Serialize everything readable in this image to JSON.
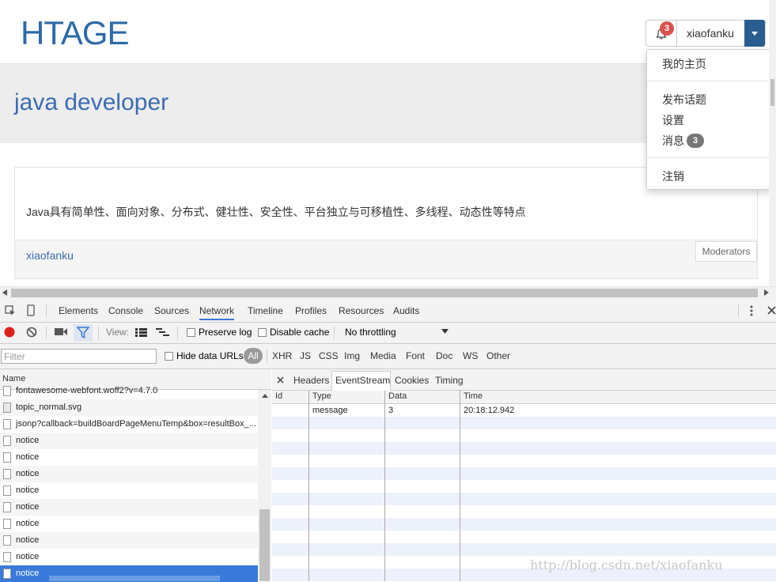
{
  "site": {
    "logo": "HTAGE",
    "banner_title": "java developer",
    "card_description": "Java具有简单性、面向对象、分布式、健壮性、安全性、平台独立与可移植性、多线程、动态性等特点",
    "card_user": "xiaofanku",
    "moderators_label": "Moderators",
    "notification_count": "3",
    "username": "xiaofanku"
  },
  "user_menu": {
    "items": [
      {
        "label": "我的主页"
      },
      {
        "label": "发布话题"
      },
      {
        "label": "设置"
      },
      {
        "label": "消息"
      },
      {
        "label": "注销"
      }
    ],
    "messages_badge": "3"
  },
  "devtools": {
    "tabs": [
      "Elements",
      "Console",
      "Sources",
      "Network",
      "Timeline",
      "Profiles",
      "Resources",
      "Audits"
    ],
    "active_tab": "Network",
    "toolbar": {
      "view_label": "View:",
      "preserve_log": "Preserve log",
      "disable_cache": "Disable cache",
      "throttling": "No throttling"
    },
    "filter": {
      "placeholder": "Filter",
      "hide_data_urls": "Hide data URLs",
      "all": "All",
      "types": [
        "XHR",
        "JS",
        "CSS",
        "Img",
        "Media",
        "Font",
        "Doc",
        "WS",
        "Other"
      ]
    },
    "requests_header": "Name",
    "requests": [
      "fontawesome-webfont.woff2?v=4.7.0",
      "topic_normal.svg",
      "jsonp?callback=buildBoardPageMenuTemp&box=resultBox_...",
      "notice",
      "notice",
      "notice",
      "notice",
      "notice",
      "notice",
      "notice",
      "notice",
      "notice"
    ],
    "detail_tabs": [
      "Headers",
      "EventStream",
      "Cookies",
      "Timing"
    ],
    "detail_active": "EventStream",
    "event_columns": [
      "Id",
      "Type",
      "Data",
      "Time"
    ],
    "events": [
      {
        "id": "",
        "type": "message",
        "data": "3",
        "time": "20:18:12.942"
      }
    ]
  },
  "watermark": "http://blog.csdn.net/xiaofanku",
  "colors": {
    "brand": "#2c6aa8",
    "badge_red": "#d9534f",
    "selected_row": "#3879d9",
    "caret_button": "#2a5d8f"
  }
}
